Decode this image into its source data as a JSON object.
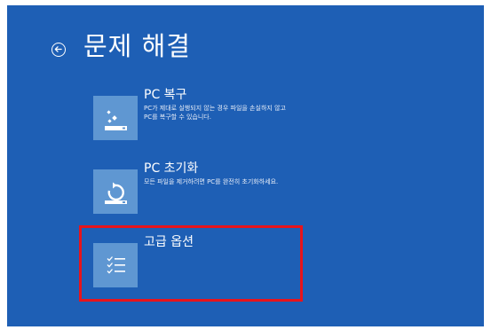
{
  "header": {
    "title": "문제 해결"
  },
  "options": [
    {
      "title": "PC 복구",
      "description": "PC가 제대로 실행되지 않는 경우 파일을 손실하지 않고 PC를 복구할 수 있습니다."
    },
    {
      "title": "PC 초기화",
      "description": "모든 파일을 제거하려면 PC를 완전히 초기화하세요."
    },
    {
      "title": "고급 옵션"
    }
  ],
  "colors": {
    "background": "#1e5fb5",
    "tile": "#5f97d2",
    "highlight": "#e8141b"
  },
  "icons": {
    "back": "back-arrow-circle-icon",
    "recovery": "sparkle-tray-icon",
    "reset": "refresh-tray-icon",
    "advanced": "checklist-icon"
  }
}
